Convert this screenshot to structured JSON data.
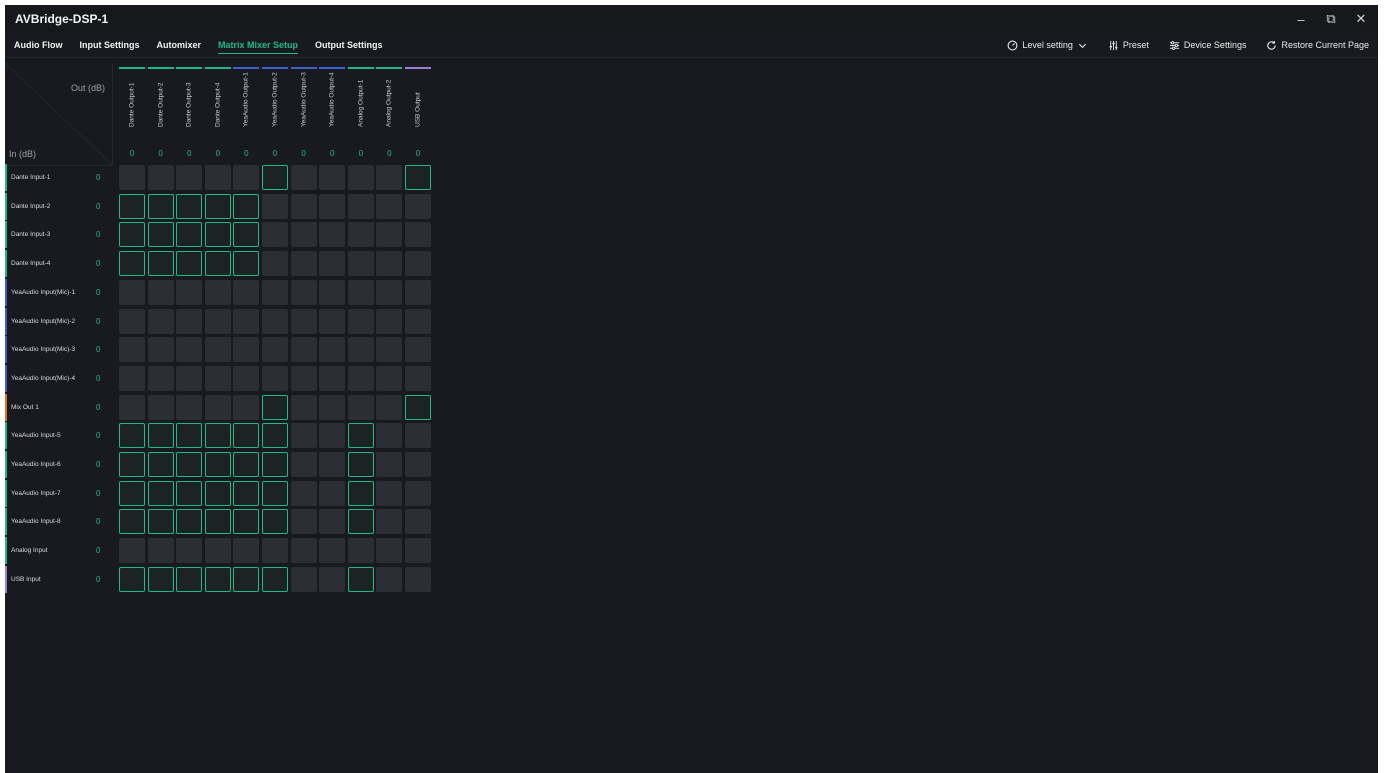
{
  "app": {
    "title": "AVBridge-DSP-1"
  },
  "window_controls": {
    "minimize": "–",
    "restore": "⧉",
    "close": "✕"
  },
  "nav": {
    "tabs": [
      {
        "label": "Audio Flow",
        "active": false
      },
      {
        "label": "Input Settings",
        "active": false
      },
      {
        "label": "Automixer",
        "active": false
      },
      {
        "label": "Matrix Mixer Setup",
        "active": true
      },
      {
        "label": "Output Settings",
        "active": false
      }
    ],
    "level_setting": "Level setting",
    "preset": "Preset",
    "device_settings": "Device Settings",
    "restore_page": "Restore Current Page"
  },
  "matrix": {
    "out_label": "Out (dB)",
    "in_label": "In (dB)",
    "outputs": [
      {
        "name": "Dante Output-1",
        "level": "0",
        "color": "#1fb889"
      },
      {
        "name": "Dante Output-2",
        "level": "0",
        "color": "#1fb889"
      },
      {
        "name": "Dante Output-3",
        "level": "0",
        "color": "#1fb889"
      },
      {
        "name": "Dante Output-4",
        "level": "0",
        "color": "#1fb889"
      },
      {
        "name": "YeaAudio Output-1",
        "level": "0",
        "color": "#3a5fcf"
      },
      {
        "name": "YeaAudio Output-2",
        "level": "0",
        "color": "#3a5fcf"
      },
      {
        "name": "YeaAudio Output-3",
        "level": "0",
        "color": "#3a5fcf"
      },
      {
        "name": "YeaAudio Output-4",
        "level": "0",
        "color": "#3a5fcf"
      },
      {
        "name": "Analog Output-1",
        "level": "0",
        "color": "#1fb889"
      },
      {
        "name": "Analog Output-2",
        "level": "0",
        "color": "#1fb889"
      },
      {
        "name": "USB Output",
        "level": "0",
        "color": "#9b7fd4"
      }
    ],
    "inputs": [
      {
        "name": "Dante Input-1",
        "level": "0",
        "color": "#1fb889",
        "routes": [
          0,
          0,
          0,
          0,
          0,
          1,
          0,
          0,
          0,
          0,
          1
        ]
      },
      {
        "name": "Dante Input-2",
        "level": "0",
        "color": "#1fb889",
        "routes": [
          1,
          1,
          1,
          1,
          1,
          0,
          0,
          0,
          0,
          0,
          0
        ]
      },
      {
        "name": "Dante Input-3",
        "level": "0",
        "color": "#1fb889",
        "routes": [
          1,
          1,
          1,
          1,
          1,
          0,
          0,
          0,
          0,
          0,
          0
        ]
      },
      {
        "name": "Dante Input-4",
        "level": "0",
        "color": "#1fb889",
        "routes": [
          1,
          1,
          1,
          1,
          1,
          0,
          0,
          0,
          0,
          0,
          0
        ]
      },
      {
        "name": "YeaAudio Input(Mic)-1",
        "level": "0",
        "color": "#3a5fcf",
        "routes": [
          0,
          0,
          0,
          0,
          0,
          0,
          0,
          0,
          0,
          0,
          0
        ]
      },
      {
        "name": "YeaAudio Input(Mic)-2",
        "level": "0",
        "color": "#3a5fcf",
        "routes": [
          0,
          0,
          0,
          0,
          0,
          0,
          0,
          0,
          0,
          0,
          0
        ]
      },
      {
        "name": "YeaAudio Input(Mic)-3",
        "level": "0",
        "color": "#3a5fcf",
        "routes": [
          0,
          0,
          0,
          0,
          0,
          0,
          0,
          0,
          0,
          0,
          0
        ]
      },
      {
        "name": "YeaAudio Input(Mic)-4",
        "level": "0",
        "color": "#3a5fcf",
        "routes": [
          0,
          0,
          0,
          0,
          0,
          0,
          0,
          0,
          0,
          0,
          0
        ]
      },
      {
        "name": "Mix Out 1",
        "level": "0",
        "color": "#d07a1f",
        "routes": [
          0,
          0,
          0,
          0,
          0,
          1,
          0,
          0,
          0,
          0,
          1
        ]
      },
      {
        "name": "YeaAudio Input-5",
        "level": "0",
        "color": "#1fb889",
        "routes": [
          1,
          1,
          1,
          1,
          1,
          1,
          0,
          0,
          1,
          0,
          0
        ]
      },
      {
        "name": "YeaAudio Input-6",
        "level": "0",
        "color": "#1fb889",
        "routes": [
          1,
          1,
          1,
          1,
          1,
          1,
          0,
          0,
          1,
          0,
          0
        ]
      },
      {
        "name": "YeaAudio Input-7",
        "level": "0",
        "color": "#1fb889",
        "routes": [
          1,
          1,
          1,
          1,
          1,
          1,
          0,
          0,
          1,
          0,
          0
        ]
      },
      {
        "name": "YeaAudio Input-8",
        "level": "0",
        "color": "#1fb889",
        "routes": [
          1,
          1,
          1,
          1,
          1,
          1,
          0,
          0,
          1,
          0,
          0
        ]
      },
      {
        "name": "Analog Input",
        "level": "0",
        "color": "#1fb889",
        "routes": [
          0,
          0,
          0,
          0,
          0,
          0,
          0,
          0,
          0,
          0,
          0
        ]
      },
      {
        "name": "USB Input",
        "level": "0",
        "color": "#9b7fd4",
        "routes": [
          1,
          1,
          1,
          1,
          1,
          1,
          0,
          0,
          1,
          0,
          0
        ]
      }
    ]
  }
}
